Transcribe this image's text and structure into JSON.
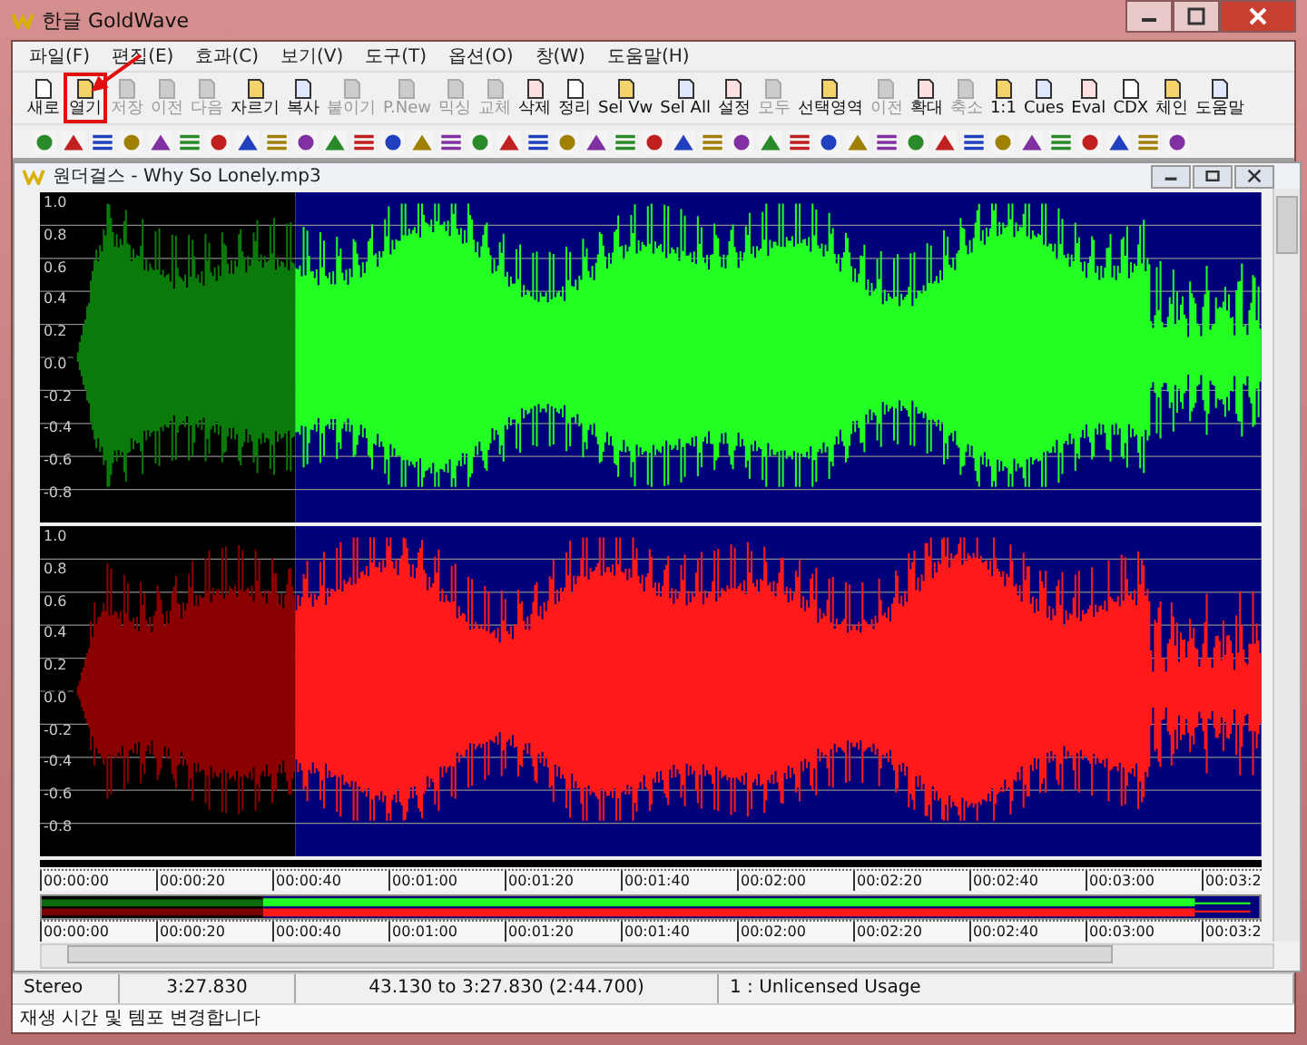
{
  "window": {
    "title": "한글 GoldWave"
  },
  "menu": [
    "파일(F)",
    "편집(E)",
    "효과(C)",
    "보기(V)",
    "도구(T)",
    "옵션(O)",
    "창(W)",
    "도움말(H)"
  ],
  "toolbar": [
    {
      "label": "새로",
      "disabled": false,
      "highlighted": false
    },
    {
      "label": "열기",
      "disabled": false,
      "highlighted": true
    },
    {
      "label": "저장",
      "disabled": true,
      "highlighted": false
    },
    {
      "label": "이전",
      "disabled": true,
      "highlighted": false
    },
    {
      "label": "다음",
      "disabled": true,
      "highlighted": false
    },
    {
      "label": "자르기",
      "disabled": false,
      "highlighted": false
    },
    {
      "label": "복사",
      "disabled": false,
      "highlighted": false
    },
    {
      "label": "붙이기",
      "disabled": true,
      "highlighted": false
    },
    {
      "label": "P.New",
      "disabled": true,
      "highlighted": false
    },
    {
      "label": "믹싱",
      "disabled": true,
      "highlighted": false
    },
    {
      "label": "교체",
      "disabled": true,
      "highlighted": false
    },
    {
      "label": "삭제",
      "disabled": false,
      "highlighted": false
    },
    {
      "label": "정리",
      "disabled": false,
      "highlighted": false
    },
    {
      "label": "Sel Vw",
      "disabled": false,
      "highlighted": false
    },
    {
      "label": "Sel All",
      "disabled": false,
      "highlighted": false
    },
    {
      "label": "설정",
      "disabled": false,
      "highlighted": false
    },
    {
      "label": "모두",
      "disabled": true,
      "highlighted": false
    },
    {
      "label": "선택영역",
      "disabled": false,
      "highlighted": false
    },
    {
      "label": "이전",
      "disabled": true,
      "highlighted": false
    },
    {
      "label": "확대",
      "disabled": false,
      "highlighted": false
    },
    {
      "label": "축소",
      "disabled": true,
      "highlighted": false
    },
    {
      "label": "1:1",
      "disabled": false,
      "highlighted": false
    },
    {
      "label": "Cues",
      "disabled": false,
      "highlighted": false
    },
    {
      "label": "Eval",
      "disabled": false,
      "highlighted": false
    },
    {
      "label": "CDX",
      "disabled": false,
      "highlighted": false
    },
    {
      "label": "체인",
      "disabled": false,
      "highlighted": false
    },
    {
      "label": "도움말",
      "disabled": false,
      "highlighted": false
    }
  ],
  "document": {
    "title": "원더걸스 - Why So Lonely.mp3",
    "channels": [
      {
        "kind": "left",
        "axis": [
          "1.0",
          "0.8",
          "0.6",
          "0.4",
          "0.2",
          "0.0",
          "-0.2",
          "-0.4",
          "-0.6",
          "-0.8"
        ]
      },
      {
        "kind": "right",
        "axis": [
          "1.0",
          "0.8",
          "0.6",
          "0.4",
          "0.2",
          "0.0",
          "-0.2",
          "-0.4",
          "-0.6",
          "-0.8"
        ]
      }
    ],
    "timeline": [
      "00:00:00",
      "00:00:20",
      "00:00:40",
      "00:01:00",
      "00:01:20",
      "00:01:40",
      "00:02:00",
      "00:02:20",
      "00:02:40",
      "00:03:00",
      "00:03:2"
    ],
    "overview_timeline": [
      "00:00:00",
      "00:00:20",
      "00:00:40",
      "00:01:00",
      "00:01:20",
      "00:01:40",
      "00:02:00",
      "00:02:20",
      "00:02:40",
      "00:03:00",
      "00:03:2"
    ]
  },
  "status_bar": {
    "channels": "Stereo",
    "length": "3:27.830",
    "selection": "43.130 to 3:27.830 (2:44.700)",
    "license": "1 : Unlicensed Usage"
  },
  "hint": "재생 시간 및 템포 변경합니다"
}
